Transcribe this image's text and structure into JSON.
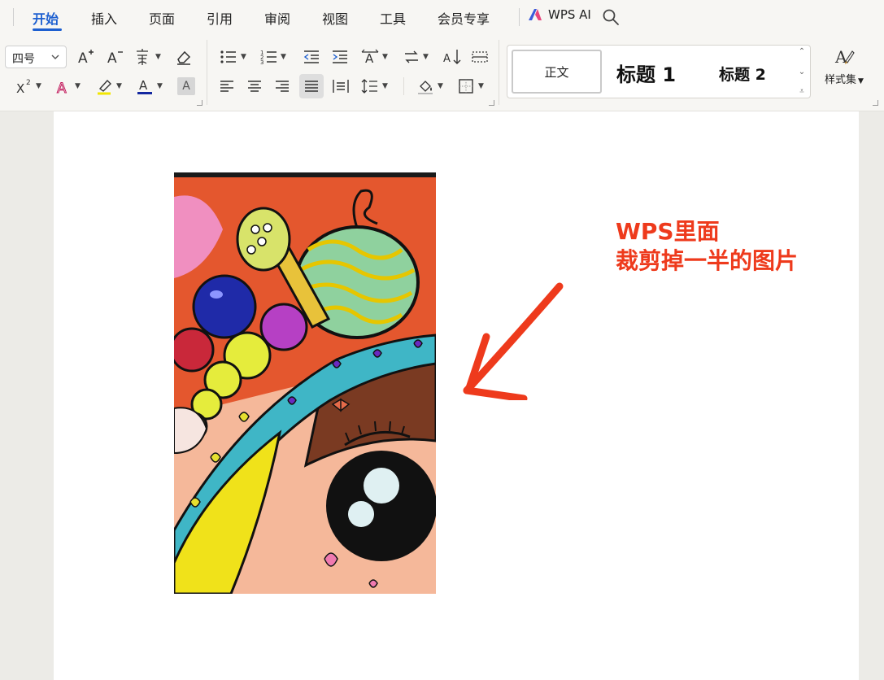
{
  "tabs": [
    {
      "label": "开始",
      "active": true
    },
    {
      "label": "插入"
    },
    {
      "label": "页面"
    },
    {
      "label": "引用"
    },
    {
      "label": "审阅"
    },
    {
      "label": "视图"
    },
    {
      "label": "工具"
    },
    {
      "label": "会员专享"
    }
  ],
  "wps_ai": {
    "label": "WPS AI"
  },
  "ribbon": {
    "font_size": "四号",
    "text_shade_glyph": "A",
    "styles": {
      "normal": "正文",
      "heading1": "标题  1",
      "heading2": "标题  2"
    },
    "style_set": "样式集"
  },
  "document": {
    "annotation_line1": "WPS里面",
    "annotation_line2": "裁剪掉一半的图片"
  },
  "colors": {
    "accent": "#1d5fd0",
    "annotation": "#ee3a1c"
  }
}
